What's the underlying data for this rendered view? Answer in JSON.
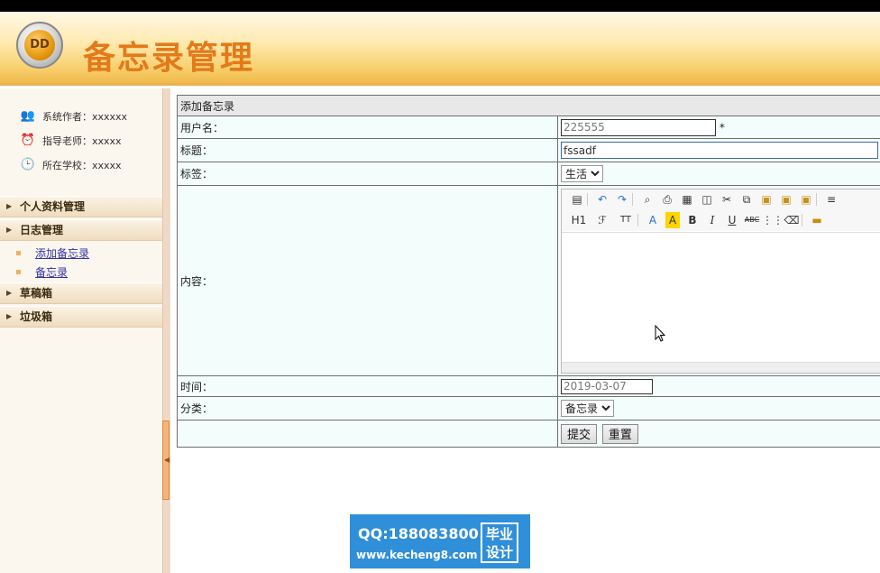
{
  "app": {
    "title": "备忘录管理",
    "logo_text": "DD"
  },
  "sidebar": {
    "info": [
      {
        "icon": "people-icon",
        "text": "系统作者：xxxxxx"
      },
      {
        "icon": "alarm-clock-icon",
        "text": "指导老师：xxxxx"
      },
      {
        "icon": "clock-icon",
        "text": "所在学校：xxxxx"
      }
    ],
    "menu": [
      {
        "label": "个人资料管理"
      },
      {
        "label": "日志管理"
      },
      {
        "label": "草稿箱"
      },
      {
        "label": "垃圾箱"
      }
    ],
    "submenu": [
      {
        "label": "添加备忘录"
      },
      {
        "label": "备忘录"
      }
    ]
  },
  "form": {
    "header": "添加备忘录",
    "username_label": "用户名：",
    "username_value": "225555",
    "required_mark": "*",
    "title_label": "标题：",
    "title_value": "fssadf",
    "tag_label": "标签：",
    "tag_value": "生活",
    "content_label": "内容：",
    "time_label": "时间：",
    "time_value": "2019-03-07",
    "category_label": "分类：",
    "category_value": "备忘录",
    "submit_label": "提交",
    "reset_label": "重置"
  },
  "editor": {
    "row2": {
      "h1": "H1",
      "font": "ℱ",
      "size": "TT",
      "color": "A",
      "bgcolor": "A",
      "bold": "B",
      "italic": "I",
      "underline": "U",
      "strike": "ABC"
    }
  },
  "watermark": {
    "qq": "QQ:188083800",
    "url": "www.kecheng8.com",
    "badge_line1": "毕业",
    "badge_line2": "设计"
  }
}
